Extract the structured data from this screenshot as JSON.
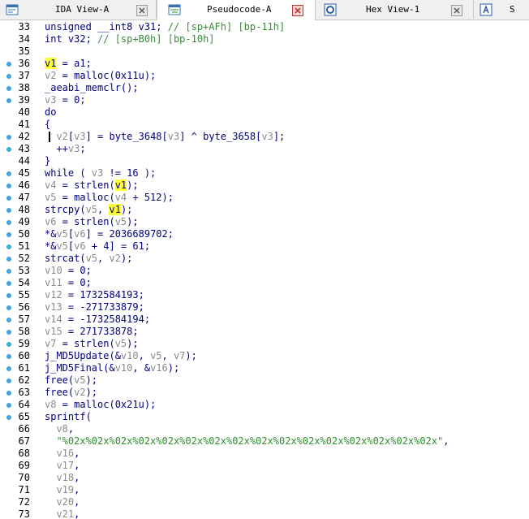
{
  "tabs": [
    {
      "label": "IDA View-A",
      "active": false,
      "icon": "ida-view-icon",
      "closable": true
    },
    {
      "label": "Pseudocode-A",
      "active": true,
      "icon": "pseudocode-icon",
      "closable": true
    },
    {
      "label": "Hex View-1",
      "active": false,
      "icon": "hex-view-icon",
      "closable": true
    },
    {
      "label": "S",
      "active": false,
      "icon": "structures-icon",
      "closable": false
    }
  ],
  "colors": {
    "keyword_blue": "#000080",
    "variable_gray": "#8b8b8b",
    "comment_green": "#3d8a3d",
    "string_green": "#2d8f2d",
    "highlight_yellow": "#ffff33",
    "breakpoint_dot": "#3fa7e0"
  },
  "code_lines": [
    {
      "n": "33",
      "bp": false,
      "segs": [
        [
          "",
          "unsigned __int8 v31; "
        ],
        [
          "c",
          "// [sp+AFh] [bp-11h]"
        ]
      ]
    },
    {
      "n": "34",
      "bp": false,
      "segs": [
        [
          "",
          "int v32; "
        ],
        [
          "c",
          "// [sp+B0h] [bp-10h]"
        ]
      ]
    },
    {
      "n": "35",
      "bp": false,
      "segs": []
    },
    {
      "n": "36",
      "bp": true,
      "segs": [
        [
          "hl",
          "v1"
        ],
        [
          "",
          " = a1;"
        ]
      ]
    },
    {
      "n": "37",
      "bp": true,
      "segs": [
        [
          "g",
          "v2"
        ],
        [
          "",
          " = malloc(0x11u);"
        ]
      ]
    },
    {
      "n": "38",
      "bp": true,
      "segs": [
        [
          "",
          "_aeabi_memclr();"
        ]
      ]
    },
    {
      "n": "39",
      "bp": true,
      "segs": [
        [
          "g",
          "v3"
        ],
        [
          "",
          " = 0;"
        ]
      ]
    },
    {
      "n": "40",
      "bp": false,
      "segs": [
        [
          "",
          "do"
        ]
      ]
    },
    {
      "n": "41",
      "bp": false,
      "segs": [
        [
          "",
          "{"
        ]
      ]
    },
    {
      "n": "42",
      "bp": true,
      "caret": true,
      "segs": [
        [
          "",
          "  "
        ],
        [
          "g",
          "v2"
        ],
        [
          "",
          "["
        ],
        [
          "g",
          "v3"
        ],
        [
          "",
          "] = byte_3648["
        ],
        [
          "g",
          "v3"
        ],
        [
          "",
          "] ^ byte_3658["
        ],
        [
          "g",
          "v3"
        ],
        [
          "",
          "];"
        ]
      ]
    },
    {
      "n": "43",
      "bp": true,
      "segs": [
        [
          "",
          "  ++"
        ],
        [
          "g",
          "v3"
        ],
        [
          "",
          ";"
        ]
      ]
    },
    {
      "n": "44",
      "bp": false,
      "segs": [
        [
          "",
          "}"
        ]
      ]
    },
    {
      "n": "45",
      "bp": true,
      "segs": [
        [
          "",
          "while ( "
        ],
        [
          "g",
          "v3"
        ],
        [
          "",
          " != 16 );"
        ]
      ]
    },
    {
      "n": "46",
      "bp": true,
      "segs": [
        [
          "g",
          "v4"
        ],
        [
          "",
          " = strlen("
        ],
        [
          "hl",
          "v1"
        ],
        [
          "",
          ");"
        ]
      ]
    },
    {
      "n": "47",
      "bp": true,
      "segs": [
        [
          "g",
          "v5"
        ],
        [
          "",
          " = malloc("
        ],
        [
          "g",
          "v4"
        ],
        [
          "",
          " + 512);"
        ]
      ]
    },
    {
      "n": "48",
      "bp": true,
      "segs": [
        [
          "",
          "strcpy("
        ],
        [
          "g",
          "v5"
        ],
        [
          "",
          ", "
        ],
        [
          "hl",
          "v1"
        ],
        [
          "",
          ");"
        ]
      ]
    },
    {
      "n": "49",
      "bp": true,
      "segs": [
        [
          "g",
          "v6"
        ],
        [
          "",
          " = strlen("
        ],
        [
          "g",
          "v5"
        ],
        [
          "",
          ");"
        ]
      ]
    },
    {
      "n": "50",
      "bp": true,
      "segs": [
        [
          "",
          "*&"
        ],
        [
          "g",
          "v5"
        ],
        [
          "",
          "["
        ],
        [
          "g",
          "v6"
        ],
        [
          "",
          "] = 2036689702;"
        ]
      ]
    },
    {
      "n": "51",
      "bp": true,
      "segs": [
        [
          "",
          "*&"
        ],
        [
          "g",
          "v5"
        ],
        [
          "",
          "["
        ],
        [
          "g",
          "v6"
        ],
        [
          "",
          " + 4] = 61;"
        ]
      ]
    },
    {
      "n": "52",
      "bp": true,
      "segs": [
        [
          "",
          "strcat("
        ],
        [
          "g",
          "v5"
        ],
        [
          "",
          ", "
        ],
        [
          "g",
          "v2"
        ],
        [
          "",
          ");"
        ]
      ]
    },
    {
      "n": "53",
      "bp": true,
      "segs": [
        [
          "g",
          "v10"
        ],
        [
          "",
          " = 0;"
        ]
      ]
    },
    {
      "n": "54",
      "bp": true,
      "segs": [
        [
          "g",
          "v11"
        ],
        [
          "",
          " = 0;"
        ]
      ]
    },
    {
      "n": "55",
      "bp": true,
      "segs": [
        [
          "g",
          "v12"
        ],
        [
          "",
          " = 1732584193;"
        ]
      ]
    },
    {
      "n": "56",
      "bp": true,
      "segs": [
        [
          "g",
          "v13"
        ],
        [
          "",
          " = -271733879;"
        ]
      ]
    },
    {
      "n": "57",
      "bp": true,
      "segs": [
        [
          "g",
          "v14"
        ],
        [
          "",
          " = -1732584194;"
        ]
      ]
    },
    {
      "n": "58",
      "bp": true,
      "segs": [
        [
          "g",
          "v15"
        ],
        [
          "",
          " = 271733878;"
        ]
      ]
    },
    {
      "n": "59",
      "bp": true,
      "segs": [
        [
          "g",
          "v7"
        ],
        [
          "",
          " = strlen("
        ],
        [
          "g",
          "v5"
        ],
        [
          "",
          ");"
        ]
      ]
    },
    {
      "n": "60",
      "bp": true,
      "segs": [
        [
          "",
          "j_MD5Update(&"
        ],
        [
          "g",
          "v10"
        ],
        [
          "",
          ", "
        ],
        [
          "g",
          "v5"
        ],
        [
          "",
          ", "
        ],
        [
          "g",
          "v7"
        ],
        [
          "",
          ");"
        ]
      ]
    },
    {
      "n": "61",
      "bp": true,
      "segs": [
        [
          "",
          "j_MD5Final(&"
        ],
        [
          "g",
          "v10"
        ],
        [
          "",
          ", &"
        ],
        [
          "g",
          "v16"
        ],
        [
          "",
          ");"
        ]
      ]
    },
    {
      "n": "62",
      "bp": true,
      "segs": [
        [
          "",
          "free("
        ],
        [
          "g",
          "v5"
        ],
        [
          "",
          ");"
        ]
      ]
    },
    {
      "n": "63",
      "bp": true,
      "segs": [
        [
          "",
          "free("
        ],
        [
          "g",
          "v2"
        ],
        [
          "",
          ");"
        ]
      ]
    },
    {
      "n": "64",
      "bp": true,
      "segs": [
        [
          "g",
          "v8"
        ],
        [
          "",
          " = malloc(0x21u);"
        ]
      ]
    },
    {
      "n": "65",
      "bp": true,
      "segs": [
        [
          "",
          "sprintf("
        ]
      ]
    },
    {
      "n": "66",
      "bp": false,
      "segs": [
        [
          "",
          "  "
        ],
        [
          "g",
          "v8"
        ],
        [
          "",
          ","
        ]
      ]
    },
    {
      "n": "67",
      "bp": false,
      "segs": [
        [
          "",
          "  "
        ],
        [
          "s",
          "\"%02x%02x%02x%02x%02x%02x%02x%02x%02x%02x%02x%02x%02x%02x%02x%02x\""
        ],
        [
          "",
          ","
        ]
      ]
    },
    {
      "n": "68",
      "bp": false,
      "segs": [
        [
          "",
          "  "
        ],
        [
          "g",
          "v16"
        ],
        [
          "",
          ","
        ]
      ]
    },
    {
      "n": "69",
      "bp": false,
      "segs": [
        [
          "",
          "  "
        ],
        [
          "g",
          "v17"
        ],
        [
          "",
          ","
        ]
      ]
    },
    {
      "n": "70",
      "bp": false,
      "segs": [
        [
          "",
          "  "
        ],
        [
          "g",
          "v18"
        ],
        [
          "",
          ","
        ]
      ]
    },
    {
      "n": "71",
      "bp": false,
      "segs": [
        [
          "",
          "  "
        ],
        [
          "g",
          "v19"
        ],
        [
          "",
          ","
        ]
      ]
    },
    {
      "n": "72",
      "bp": false,
      "segs": [
        [
          "",
          "  "
        ],
        [
          "g",
          "v20"
        ],
        [
          "",
          ","
        ]
      ]
    },
    {
      "n": "73",
      "bp": false,
      "segs": [
        [
          "",
          "  "
        ],
        [
          "g",
          "v21"
        ],
        [
          "",
          ","
        ]
      ]
    }
  ]
}
